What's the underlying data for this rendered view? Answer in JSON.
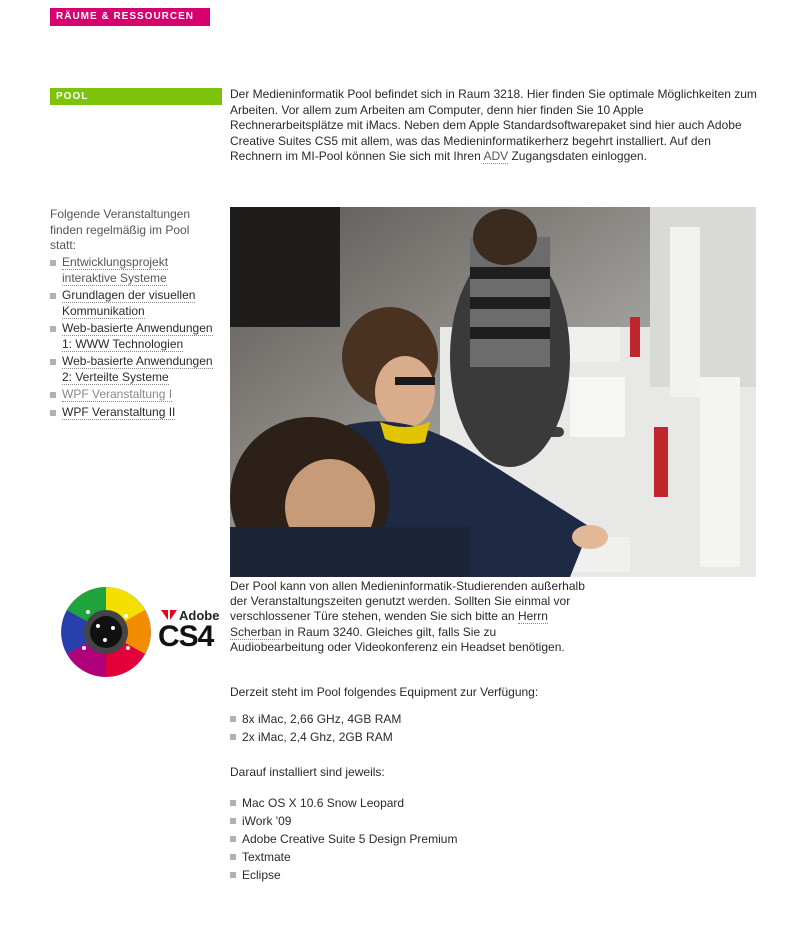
{
  "header": {
    "section_badge": "RÄUME & RESSOURCEN"
  },
  "pool": {
    "badge": "POOL",
    "intro_before_link": "Der Medieninformatik Pool befindet sich in Raum 3218. Hier finden Sie optimale Möglichkeiten zum Arbeiten. Vor allem zum Arbeiten am Computer, denn hier finden Sie 10 Apple Rechnerarbeitsplätze mit iMacs. Neben dem Apple Standardsoftwarepaket sind hier auch Adobe Creative Suites CS5 mit allem, was das Medieninformatikerherz begehrt installiert. Auf den Rechnern im MI-Pool können Sie sich mit Ihren ",
    "intro_link": "ADV",
    "intro_after_link": " Zugangsdaten einloggen."
  },
  "sidebar": {
    "intro": "Folgende Veranstaltungen finden regelmäßig im Pool statt:",
    "courses": [
      {
        "label": "Entwicklungsprojekt interaktive Systeme"
      },
      {
        "label": "Grundlagen der visuellen Kommunikation"
      },
      {
        "label": "Web-basierte Anwendungen 1: WWW Technologien"
      },
      {
        "label": "Web-basierte Anwendungen 2: Verteilte Systeme"
      },
      {
        "label": "WPF Veranstaltung I"
      },
      {
        "label": "WPF Veranstaltung II"
      }
    ]
  },
  "logo": {
    "brand": "Adobe",
    "product": "CS4"
  },
  "usage": {
    "text_before_link": "Der Pool kann von allen Medieninformatik-Studierenden außerhalb der Veranstaltungszeiten genutzt werden. Sollten Sie einmal vor verschlossener Türe stehen, wenden Sie sich bitte an ",
    "link": "Herrn Scherban",
    "text_after_link": " in Raum 3240. Gleiches gilt, falls Sie zu Audiobearbeitung oder Videokonferenz ein Headset benötigen."
  },
  "equipment": {
    "title": "Derzeit steht im Pool folgendes Equipment zur Verfügung:",
    "items": [
      "8x iMac, 2,66 GHz, 4GB RAM",
      "2x iMac, 2,4 Ghz, 2GB RAM"
    ]
  },
  "installed": {
    "title": "Darauf installiert sind jeweils:",
    "items": [
      "Mac OS X 10.6 Snow Leopard",
      "iWork '09",
      "Adobe Creative Suite 5 Design Premium",
      "Textmate",
      "Eclipse"
    ]
  },
  "colors": {
    "magenta": "#d6006e",
    "green": "#7dc30c",
    "bullet": "#b8b0a8"
  }
}
